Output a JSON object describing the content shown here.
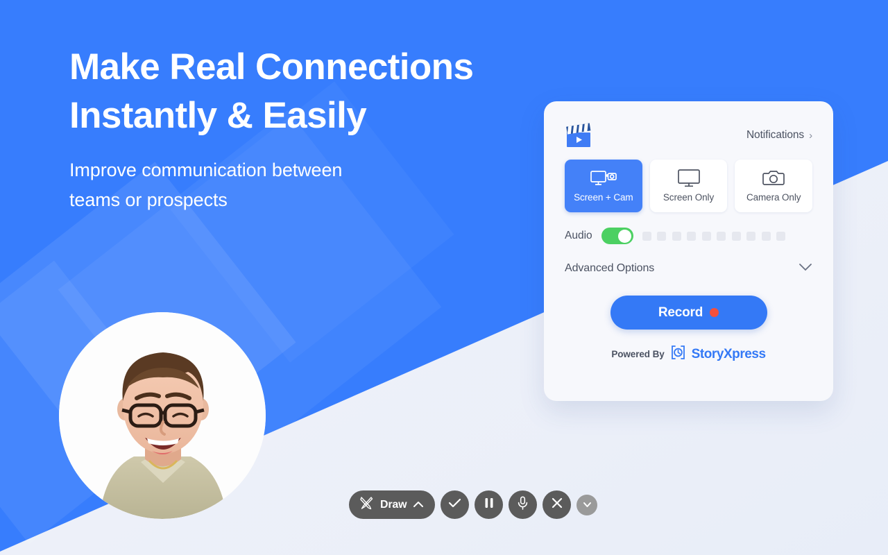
{
  "hero": {
    "heading_line1": "Make Real Connections",
    "heading_line2": "Instantly & Easily",
    "subheading_line1": "Improve communication between",
    "subheading_line2": "teams or prospects"
  },
  "avatar": {
    "name": "smiling-man-with-glasses-portrait"
  },
  "colors": {
    "background_blue": "#377dfd",
    "accent_blue": "#3479f6",
    "card_background": "#f7f8fc",
    "toggle_green": "#4cd062",
    "record_dot_red": "#f4503c",
    "toolbar_gray": "#5b5b5b",
    "toolbar_light_gray": "#9a9a9a",
    "brand_blue": "#3479f6"
  },
  "card": {
    "app_icon": "clapperboard-icon",
    "notifications": {
      "label": "Notifications",
      "chevron": "›"
    },
    "modes": [
      {
        "label": "Screen + Cam",
        "icon": "monitor-plus-camera-icon",
        "active": true
      },
      {
        "label": "Screen Only",
        "icon": "monitor-icon",
        "active": false
      },
      {
        "label": "Camera Only",
        "icon": "camera-icon",
        "active": false
      }
    ],
    "audio": {
      "label": "Audio",
      "toggle_on": true,
      "meter_segments": 10,
      "meter_active": 0
    },
    "advanced": {
      "label": "Advanced Options",
      "icon": "chevron-down-icon",
      "expanded": false
    },
    "record": {
      "label": "Record",
      "indicator": "record-dot"
    },
    "powered": {
      "prefix": "Powered By",
      "brand": "StoryXpress",
      "mark": "bracket-circle-logo"
    }
  },
  "toolbar": {
    "draw": {
      "label": "Draw",
      "icon": "crossed-pens-icon",
      "chevron": "chevron-up-icon"
    },
    "buttons": [
      {
        "name": "finish-button",
        "icon": "check-icon"
      },
      {
        "name": "pause-button",
        "icon": "pause-icon"
      },
      {
        "name": "microphone-button",
        "icon": "microphone-icon"
      },
      {
        "name": "cancel-button",
        "icon": "close-icon"
      },
      {
        "name": "collapse-button",
        "icon": "chevron-down-icon"
      }
    ]
  }
}
